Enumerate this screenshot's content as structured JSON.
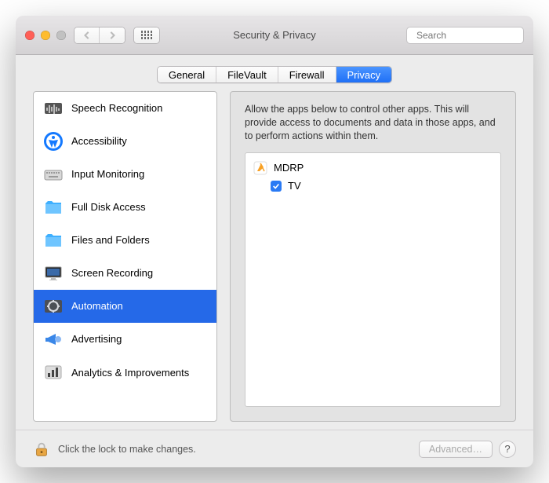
{
  "window": {
    "title": "Security & Privacy"
  },
  "search": {
    "placeholder": "Search"
  },
  "tabs": {
    "items": [
      "General",
      "FileVault",
      "Firewall",
      "Privacy"
    ],
    "selected": "Privacy"
  },
  "sidebar": {
    "items": [
      {
        "label": "Speech Recognition",
        "icon": "waveform-icon"
      },
      {
        "label": "Accessibility",
        "icon": "accessibility-icon"
      },
      {
        "label": "Input Monitoring",
        "icon": "keyboard-icon"
      },
      {
        "label": "Full Disk Access",
        "icon": "disk-folder-icon"
      },
      {
        "label": "Files and Folders",
        "icon": "folder-icon"
      },
      {
        "label": "Screen Recording",
        "icon": "display-icon"
      },
      {
        "label": "Automation",
        "icon": "gear-icon",
        "selected": true
      },
      {
        "label": "Advertising",
        "icon": "megaphone-icon"
      },
      {
        "label": "Analytics & Improvements",
        "icon": "barchart-icon"
      }
    ]
  },
  "panel": {
    "description": "Allow the apps below to control other apps. This will provide access to documents and data in those apps, and to perform actions within them.",
    "apps": [
      {
        "name": "MDRP",
        "children": [
          {
            "name": "TV",
            "checked": true
          }
        ]
      }
    ]
  },
  "footer": {
    "lock_label": "Click the lock to make changes.",
    "advanced_label": "Advanced…"
  }
}
